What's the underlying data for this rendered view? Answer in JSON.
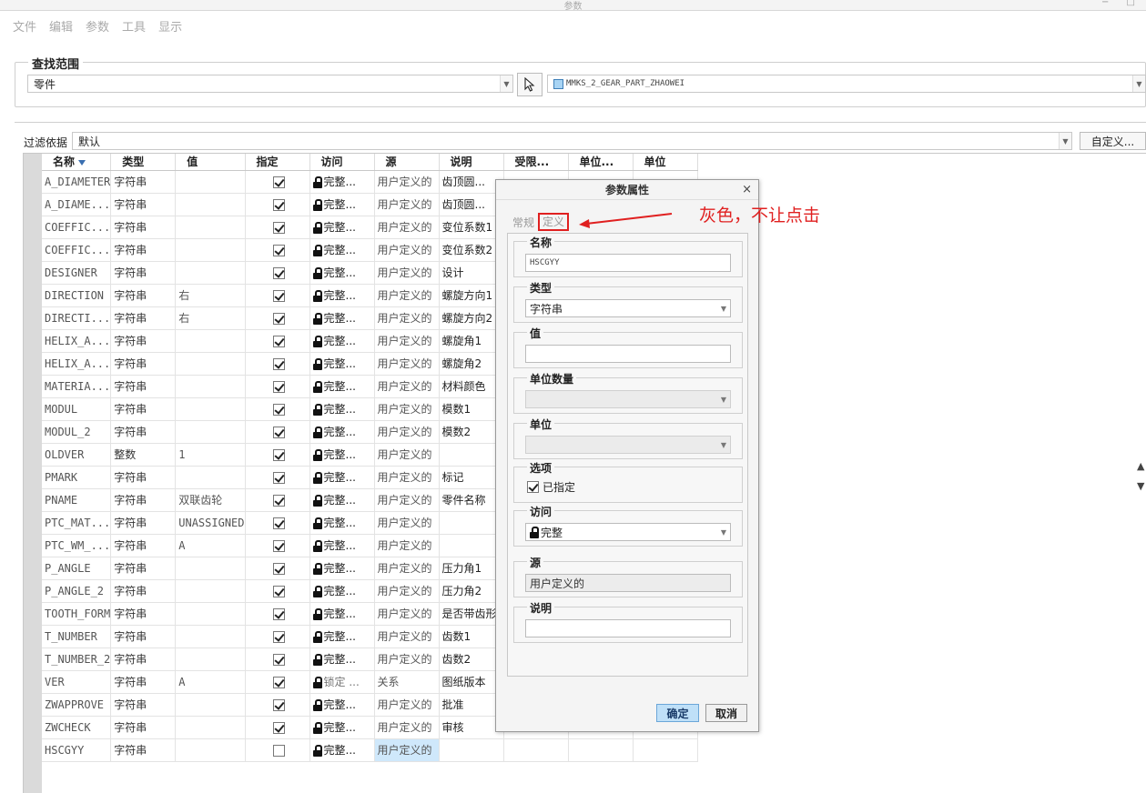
{
  "window": {
    "title": "参数",
    "controls": "− □"
  },
  "menu": [
    "文件",
    "编辑",
    "参数",
    "工具",
    "显示"
  ],
  "search": {
    "group_title": "查找范围",
    "scope_value": "零件",
    "model_value": "MMKS_2_GEAR_PART_ZHAOWEI"
  },
  "filter": {
    "label": "过滤依据",
    "value": "默认",
    "custom_button": "自定义..."
  },
  "table": {
    "headers": [
      "名称",
      "类型",
      "值",
      "指定",
      "访问",
      "源",
      "说明",
      "受限...",
      "单位...",
      "单位"
    ],
    "rows": [
      {
        "name": "A_DIAMETER",
        "type": "字符串",
        "value": "",
        "designated": true,
        "access": "完整...",
        "source": "用户定义的",
        "desc": "齿顶圆..."
      },
      {
        "name": "A_DIAME...",
        "type": "字符串",
        "value": "",
        "designated": true,
        "access": "完整...",
        "source": "用户定义的",
        "desc": "齿顶圆..."
      },
      {
        "name": "COEFFIC...",
        "type": "字符串",
        "value": "",
        "designated": true,
        "access": "完整...",
        "source": "用户定义的",
        "desc": "变位系数1"
      },
      {
        "name": "COEFFIC...",
        "type": "字符串",
        "value": "",
        "designated": true,
        "access": "完整...",
        "source": "用户定义的",
        "desc": "变位系数2"
      },
      {
        "name": "DESIGNER",
        "type": "字符串",
        "value": "",
        "designated": true,
        "access": "完整...",
        "source": "用户定义的",
        "desc": "设计"
      },
      {
        "name": "DIRECTION",
        "type": "字符串",
        "value": "右",
        "designated": true,
        "access": "完整...",
        "source": "用户定义的",
        "desc": "螺旋方向1"
      },
      {
        "name": "DIRECTI...",
        "type": "字符串",
        "value": "右",
        "designated": true,
        "access": "完整...",
        "source": "用户定义的",
        "desc": "螺旋方向2"
      },
      {
        "name": "HELIX_A...",
        "type": "字符串",
        "value": "",
        "designated": true,
        "access": "完整...",
        "source": "用户定义的",
        "desc": "螺旋角1"
      },
      {
        "name": "HELIX_A...",
        "type": "字符串",
        "value": "",
        "designated": true,
        "access": "完整...",
        "source": "用户定义的",
        "desc": "螺旋角2"
      },
      {
        "name": "MATERIA...",
        "type": "字符串",
        "value": "",
        "designated": true,
        "access": "完整...",
        "source": "用户定义的",
        "desc": "材料颜色"
      },
      {
        "name": "MODUL",
        "type": "字符串",
        "value": "",
        "designated": true,
        "access": "完整...",
        "source": "用户定义的",
        "desc": "模数1"
      },
      {
        "name": "MODUL_2",
        "type": "字符串",
        "value": "",
        "designated": true,
        "access": "完整...",
        "source": "用户定义的",
        "desc": "模数2"
      },
      {
        "name": "OLDVER",
        "type": "整数",
        "value": "1",
        "designated": true,
        "access": "完整...",
        "source": "用户定义的",
        "desc": ""
      },
      {
        "name": "PMARK",
        "type": "字符串",
        "value": "",
        "designated": true,
        "access": "完整...",
        "source": "用户定义的",
        "desc": "标记"
      },
      {
        "name": "PNAME",
        "type": "字符串",
        "value": "双联齿轮",
        "designated": true,
        "access": "完整...",
        "source": "用户定义的",
        "desc": "零件名称"
      },
      {
        "name": "PTC_MAT...",
        "type": "字符串",
        "value": "UNASSIGNED",
        "designated": true,
        "access": "完整...",
        "source": "用户定义的",
        "desc": ""
      },
      {
        "name": "PTC_WM_...",
        "type": "字符串",
        "value": "A",
        "designated": true,
        "access": "完整...",
        "source": "用户定义的",
        "desc": ""
      },
      {
        "name": "P_ANGLE",
        "type": "字符串",
        "value": "",
        "designated": true,
        "access": "完整...",
        "source": "用户定义的",
        "desc": "压力角1"
      },
      {
        "name": "P_ANGLE_2",
        "type": "字符串",
        "value": "",
        "designated": true,
        "access": "完整...",
        "source": "用户定义的",
        "desc": "压力角2"
      },
      {
        "name": "TOOTH_FORM",
        "type": "字符串",
        "value": "",
        "designated": true,
        "access": "完整...",
        "source": "用户定义的",
        "desc": "是否带齿形"
      },
      {
        "name": "T_NUMBER",
        "type": "字符串",
        "value": "",
        "designated": true,
        "access": "完整...",
        "source": "用户定义的",
        "desc": "齿数1"
      },
      {
        "name": "T_NUMBER_2",
        "type": "字符串",
        "value": "",
        "designated": true,
        "access": "完整...",
        "source": "用户定义的",
        "desc": "齿数2"
      },
      {
        "name": "VER",
        "type": "字符串",
        "value": "A",
        "designated": true,
        "access": "锁定 ...",
        "source": "关系",
        "desc": "图纸版本",
        "gray": true
      },
      {
        "name": "ZWAPPROVE",
        "type": "字符串",
        "value": "",
        "designated": true,
        "access": "完整...",
        "source": "用户定义的",
        "desc": "批准"
      },
      {
        "name": "ZWCHECK",
        "type": "字符串",
        "value": "",
        "designated": true,
        "access": "完整...",
        "source": "用户定义的",
        "desc": "审核"
      },
      {
        "name": "HSCGYY",
        "type": "字符串",
        "value": "",
        "designated": false,
        "access": "完整...",
        "source": "用户定义的",
        "desc": "",
        "selected": true
      }
    ]
  },
  "dialog": {
    "title": "参数属性",
    "close": "×",
    "tabs": [
      "常规",
      "定义"
    ],
    "fields": {
      "name_label": "名称",
      "name_value": "HSCGYY",
      "type_label": "类型",
      "type_value": "字符串",
      "value_label": "值",
      "value_value": "",
      "unit_qty_label": "单位数量",
      "unit_qty_value": "",
      "unit_label": "单位",
      "unit_value": "",
      "options_label": "选项",
      "designated_label": "已指定",
      "access_label": "访问",
      "access_value": "完整",
      "source_label": "源",
      "source_value": "用户定义的",
      "desc_label": "说明",
      "desc_value": ""
    },
    "ok": "确定",
    "cancel": "取消"
  },
  "annotation": {
    "text": "灰色，不让点击",
    "color": "#e02020"
  },
  "icons": {
    "side": [
      "up-arrow-icon",
      "down-arrow-icon"
    ]
  }
}
